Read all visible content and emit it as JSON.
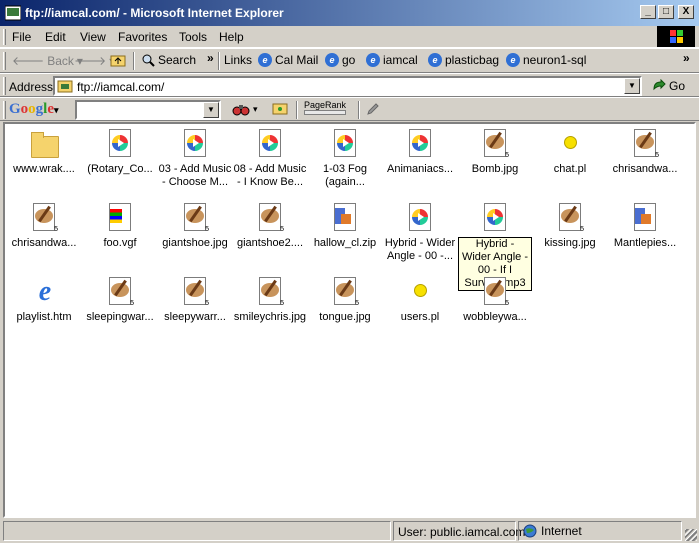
{
  "window": {
    "title": "ftp://iamcal.com/ - Microsoft Internet Explorer",
    "min_label": "_",
    "max_label": "□",
    "close_label": "X"
  },
  "menu": {
    "items": [
      "File",
      "Edit",
      "View",
      "Favorites",
      "Tools",
      "Help"
    ],
    "underline": [
      "F",
      "E",
      "V",
      "a",
      "T",
      "H"
    ]
  },
  "toolbar": {
    "back_label": "Back",
    "forward_label": "",
    "search_label": "Search",
    "more": "»",
    "links_label": "Links",
    "links": [
      "Cal Mail",
      "go",
      "iamcal",
      "plasticbag",
      "neuron1-sql"
    ]
  },
  "address": {
    "label": "Address",
    "value": "ftp://iamcal.com/",
    "go_label": "Go"
  },
  "google_bar": {
    "logo": "Google",
    "search_value": "",
    "pagerank_label": "PageRank"
  },
  "files": [
    {
      "name": "www.wrak....",
      "type": "folder"
    },
    {
      "name": "(Rotary_Co...",
      "type": "media"
    },
    {
      "name": "03 - Add Music - Choose M...",
      "type": "media"
    },
    {
      "name": "08 - Add Music - I Know Be...",
      "type": "media"
    },
    {
      "name": "1-03 Fog (again...",
      "type": "media"
    },
    {
      "name": "Animaniacs...",
      "type": "media"
    },
    {
      "name": "Bomb.jpg",
      "type": "image"
    },
    {
      "name": "chat.pl",
      "type": "script"
    },
    {
      "name": "chrisandwa...",
      "type": "image"
    },
    {
      "name": "chrisandwa...",
      "type": "image"
    },
    {
      "name": "foo.vgf",
      "type": "vgf"
    },
    {
      "name": "giantshoe.jpg",
      "type": "image"
    },
    {
      "name": "giantshoe2....",
      "type": "image"
    },
    {
      "name": "hallow_cl.zip",
      "type": "zip"
    },
    {
      "name": "Hybrid - Wider Angle - 00 -...",
      "type": "media"
    },
    {
      "name": "Hybrid - Wider Angle - 00 - If I Survive.mp3",
      "type": "media",
      "selected": true
    },
    {
      "name": "kissing.jpg",
      "type": "image"
    },
    {
      "name": "Mantlepies...",
      "type": "zip"
    },
    {
      "name": "playlist.htm",
      "type": "html"
    },
    {
      "name": "sleepingwar...",
      "type": "image"
    },
    {
      "name": "sleepywarr...",
      "type": "image"
    },
    {
      "name": "smileychris.jpg",
      "type": "image"
    },
    {
      "name": "tongue.jpg",
      "type": "image"
    },
    {
      "name": "users.pl",
      "type": "script"
    },
    {
      "name": "wobbleywa...",
      "type": "image"
    }
  ],
  "status": {
    "user": "User: public.iamcal.com",
    "zone": "Internet"
  }
}
